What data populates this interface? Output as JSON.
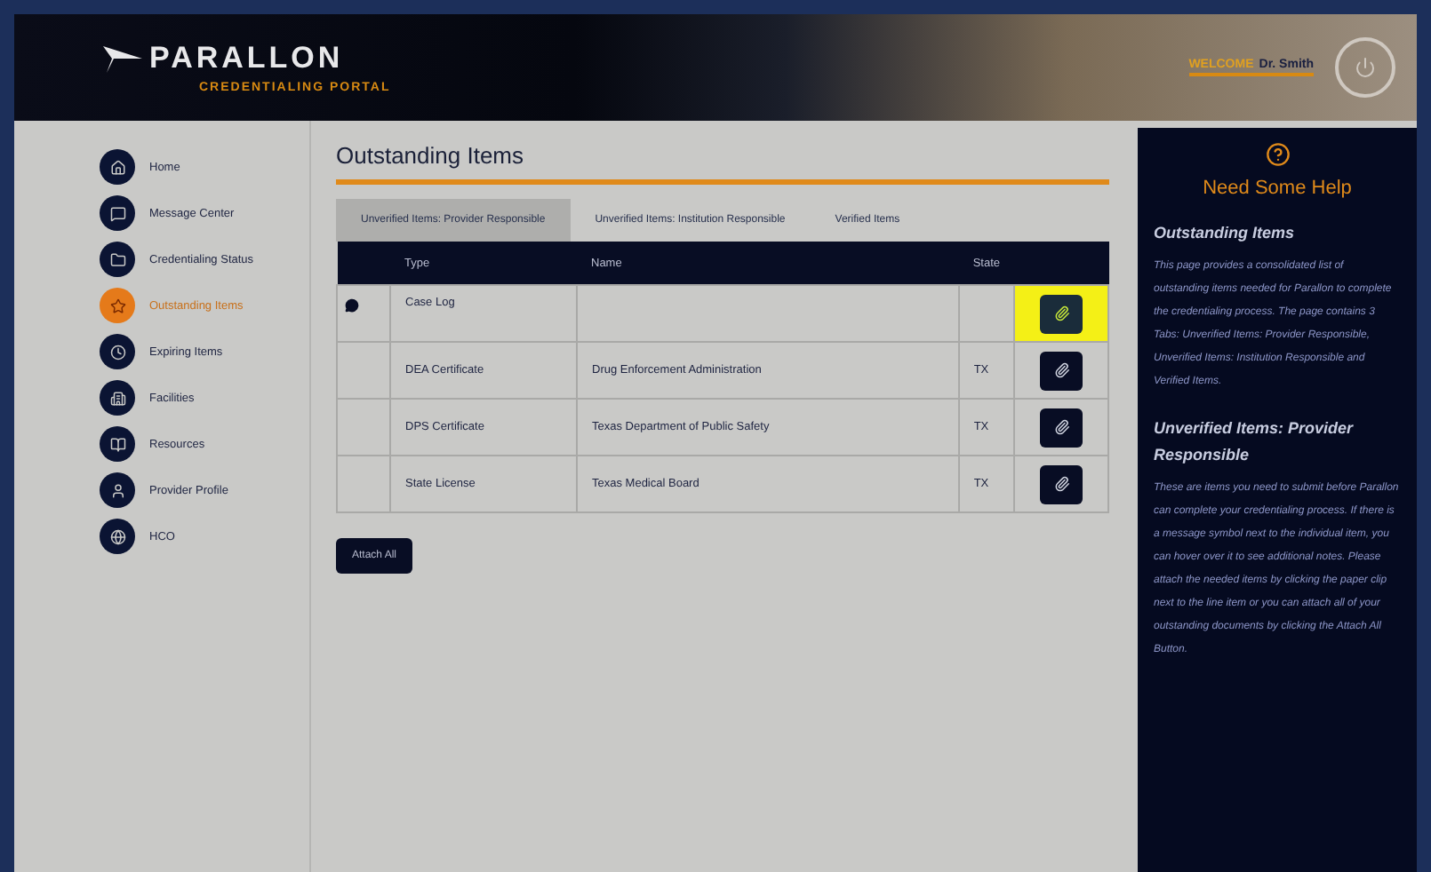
{
  "header": {
    "logo": "PARALLON",
    "subtitle": "CREDENTIALING PORTAL",
    "welcome": "WELCOME",
    "user": "Dr. Smith"
  },
  "sidebar": {
    "items": [
      {
        "label": "Home",
        "selected": false
      },
      {
        "label": "Message Center",
        "selected": false
      },
      {
        "label": "Credentialing Status",
        "selected": false
      },
      {
        "label": "Outstanding Items",
        "selected": true
      },
      {
        "label": "Expiring Items",
        "selected": false
      },
      {
        "label": "Facilities",
        "selected": false
      },
      {
        "label": "Resources",
        "selected": false
      },
      {
        "label": "Provider Profile",
        "selected": false
      },
      {
        "label": "HCO",
        "selected": false
      }
    ]
  },
  "main": {
    "title": "Outstanding Items",
    "tabs": [
      {
        "label": "Unverified Items: Provider Responsible",
        "selected": true
      },
      {
        "label": "Unverified Items: Institution Responsible",
        "selected": false
      },
      {
        "label": "Verified Items",
        "selected": false
      }
    ],
    "table": {
      "columns": [
        "Type",
        "Name",
        "State"
      ],
      "rows": [
        {
          "type": "Case Log",
          "name": "",
          "state": "",
          "note": true,
          "highlighted": true
        },
        {
          "type": "DEA Certificate",
          "name": "Drug Enforcement Administration",
          "state": "TX",
          "note": false,
          "highlighted": false
        },
        {
          "type": "DPS Certificate",
          "name": "Texas Department of Public Safety",
          "state": "TX",
          "note": false,
          "highlighted": false
        },
        {
          "type": "State License",
          "name": "Texas Medical Board",
          "state": "TX",
          "note": false,
          "highlighted": false
        }
      ]
    },
    "attach_all": "Attach All"
  },
  "help": {
    "title": "Need Some Help",
    "sections": [
      {
        "heading": "Outstanding Items",
        "text": "This page provides a consolidated list of outstanding items needed for Parallon to complete the credentialing process. The page contains 3 Tabs: Unverified Items: Provider Responsible, Unverified Items: Institution Responsible and Verified Items."
      },
      {
        "heading": "Unverified Items: Provider Responsible",
        "text": "These are items you need to submit before Parallon can complete your credentialing process. If there is a message symbol next to the individual item, you can hover over it to see additional notes. Please attach the needed items by clicking the paper clip next to the line item or you can attach all of your outstanding documents by clicking the Attach All Button."
      }
    ]
  }
}
